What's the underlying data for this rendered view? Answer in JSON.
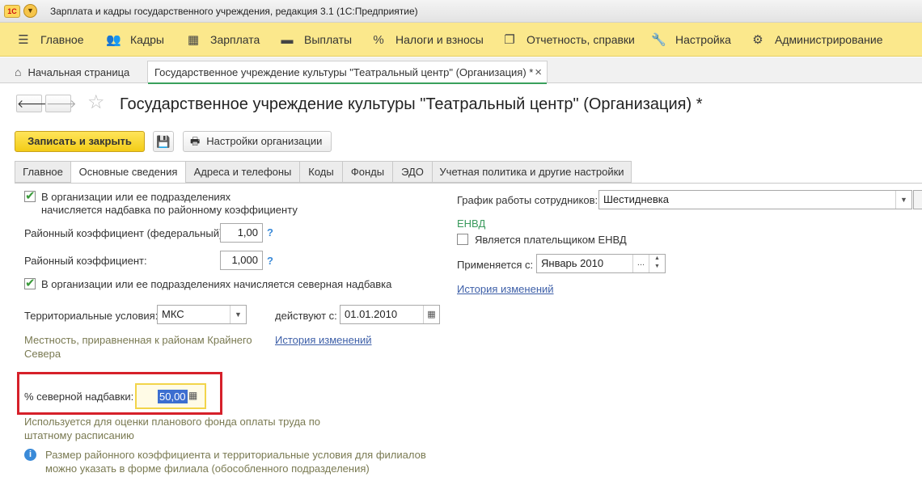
{
  "window": {
    "logo": "1С",
    "title": "Зарплата и кадры государственного учреждения, редакция 3.1  (1С:Предприятие)"
  },
  "menu": {
    "items": [
      {
        "label": "Главное",
        "icon": "hamburger-icon"
      },
      {
        "label": "Кадры",
        "icon": "people-icon"
      },
      {
        "label": "Зарплата",
        "icon": "calculator-icon"
      },
      {
        "label": "Выплаты",
        "icon": "wallet-icon"
      },
      {
        "label": "Налоги и взносы",
        "icon": "percent-icon"
      },
      {
        "label": "Отчетность, справки",
        "icon": "documents-icon"
      },
      {
        "label": "Настройка",
        "icon": "wrench-icon"
      },
      {
        "label": "Администрирование",
        "icon": "gear-icon"
      }
    ]
  },
  "tabs": {
    "home": "Начальная страница",
    "doc": "Государственное учреждение культуры \"Театральный центр\" (Организация) *",
    "close": "×"
  },
  "form": {
    "title": "Государственное учреждение культуры \"Театральный центр\" (Организация) *",
    "save_close": "Записать и закрыть",
    "settings": "Настройки организации"
  },
  "form_tabs": [
    "Главное",
    "Основные сведения",
    "Адреса и телефоны",
    "Коды",
    "Фонды",
    "ЭДО",
    "Учетная политика и другие настройки"
  ],
  "left": {
    "regional_check_line1": "В организации или ее подразделениях",
    "regional_check_line2": "начисляется надбавка по районному коэффициенту",
    "coef_federal_label": "Районный коэффициент (федеральный):",
    "coef_federal_value": "1,00",
    "coef_label": "Районный коэффициент:",
    "coef_value": "1,000",
    "help": "?",
    "north_check": "В организации или ее подразделениях начисляется северная надбавка",
    "terr_label": "Территориальные условия:",
    "terr_value": "МКС",
    "valid_from_label": "действуют с:",
    "valid_from_value": "01.01.2010",
    "locality_line1": "Местность, приравненная к районам Крайнего",
    "locality_line2": "Севера",
    "history": "История изменений",
    "north_pct_label": "% северной надбавки:",
    "north_pct_value": "50,00",
    "usage_line1": "Используется для оценки планового фонда оплаты труда по",
    "usage_line2": "штатному расписанию",
    "info_line1": "Размер районного коэффициента и территориальные условия для филиалов",
    "info_line2": "можно указать в форме филиала (обособленного подразделения)"
  },
  "right": {
    "schedule_label": "График работы сотрудников:",
    "schedule_value": "Шестидневка",
    "envd_header": "ЕНВД",
    "envd_check": "Является плательщиком ЕНВД",
    "applies_label": "Применяется с:",
    "applies_value": "Январь 2010",
    "history": "История изменений"
  },
  "colors": {
    "menu_bg": "#fbe88c",
    "accent_button": "#f3cc17",
    "highlight_border": "#d6202a",
    "link": "#3d5fa8"
  }
}
